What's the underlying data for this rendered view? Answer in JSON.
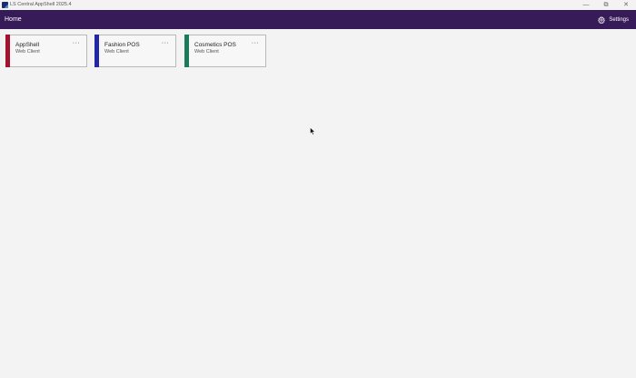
{
  "window": {
    "title": "LS Central AppShell 2025.4",
    "controls": {
      "minimize": "—",
      "restore": "⧉",
      "close": "✕"
    }
  },
  "navbar": {
    "title": "Home",
    "settings_label": "Settings",
    "background": "#371b58"
  },
  "tiles": [
    {
      "name": "AppShell",
      "subtitle": "Web Client",
      "accent": "#a3122f",
      "more": "···"
    },
    {
      "name": "Fashion POS",
      "subtitle": "Web Client",
      "accent": "#2227a8",
      "more": "···"
    },
    {
      "name": "Cosmetics POS",
      "subtitle": "Web Client",
      "accent": "#1b7a5a",
      "more": "···"
    }
  ]
}
